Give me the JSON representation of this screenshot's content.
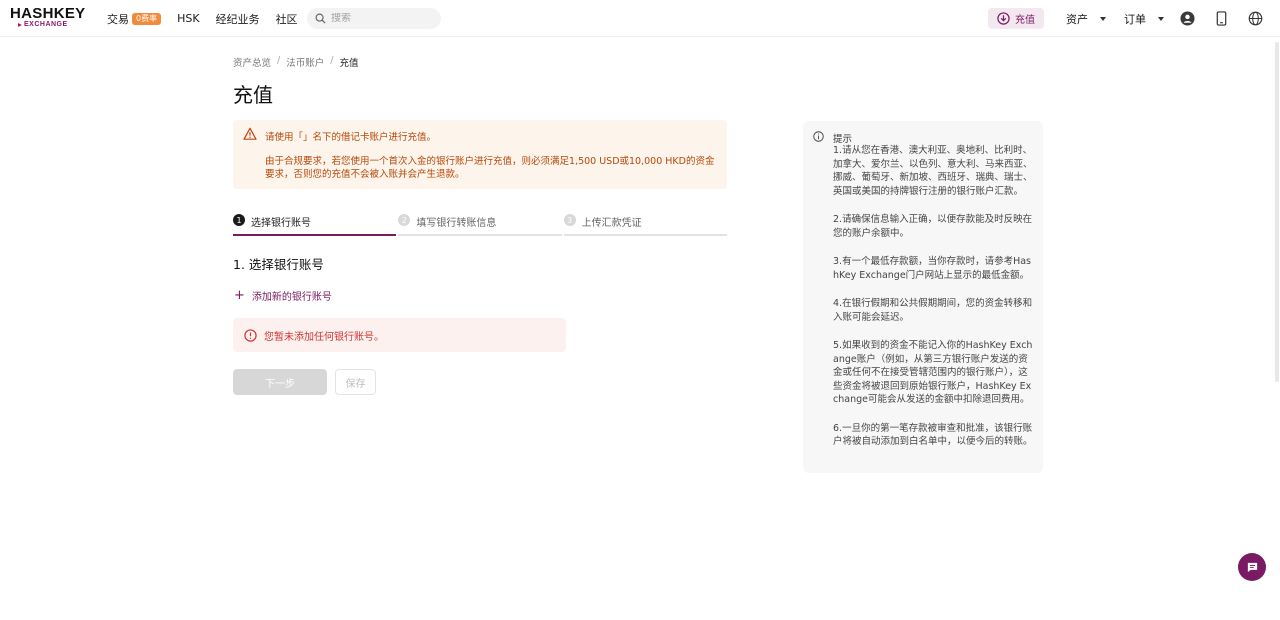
{
  "header": {
    "logo_top": "HASHKEY",
    "logo_bottom": "EXCHANGE",
    "nav": [
      {
        "label": "交易",
        "badge": "0费率"
      },
      {
        "label": "HSK"
      },
      {
        "label": "经纪业务"
      },
      {
        "label": "社区"
      }
    ],
    "search_placeholder": "搜索",
    "deposit_label": "充值",
    "assets_label": "资产",
    "orders_label": "订单"
  },
  "breadcrumb": [
    "资产总览",
    "法币账户",
    "充值"
  ],
  "page_title": "充值",
  "warning": {
    "line1": "请使用「」名下的借记卡账户进行充值。",
    "line2": "由于合规要求，若您使用一个首次入金的银行账户进行充值，则必须满足1,500 USD或10,000 HKD的资金要求，否则您的充值不会被入账并会产生退款。"
  },
  "steps": [
    {
      "num": "1",
      "label": "选择银行账号"
    },
    {
      "num": "2",
      "label": "填写银行转账信息"
    },
    {
      "num": "3",
      "label": "上传汇款凭证"
    }
  ],
  "section_title": "1. 选择银行账号",
  "add_bank_label": "添加新的银行账号",
  "empty_error": "您暂未添加任何银行账号。",
  "next_label": "下一步",
  "save_label": "保存",
  "tips": {
    "title": "提示",
    "items": [
      "1.请从您在香港、澳大利亚、奥地利、比利时、加拿大、爱尔兰、以色列、意大利、马来西亚、挪威、葡萄牙、新加坡、西班牙、瑞典、瑞士、英国或美国的持牌银行注册的银行账户汇款。",
      "2.请确保信息输入正确，以便存款能及时反映在您的账户余额中。",
      "3.有一个最低存款额，当你存款时，请参考HashKey Exchange门户网站上显示的最低金额。",
      "4.在银行假期和公共假期期间，您的资金转移和入账可能会延迟。",
      "5.如果收到的资金不能记入你的HashKey Exchange账户（例如，从第三方银行账户发送的资金或任何不在接受管辖范围内的银行账户），这些资金将被退回到原始银行账户，HashKey Exchange可能会从发送的金额中扣除退回费用。",
      "6.一旦你的第一笔存款被审查和批准，该银行账户将被自动添加到白名单中，以便今后的转账。"
    ]
  },
  "colors": {
    "brand": "#7a1a62",
    "warning_text": "#b54708",
    "error_text": "#d1342f"
  }
}
